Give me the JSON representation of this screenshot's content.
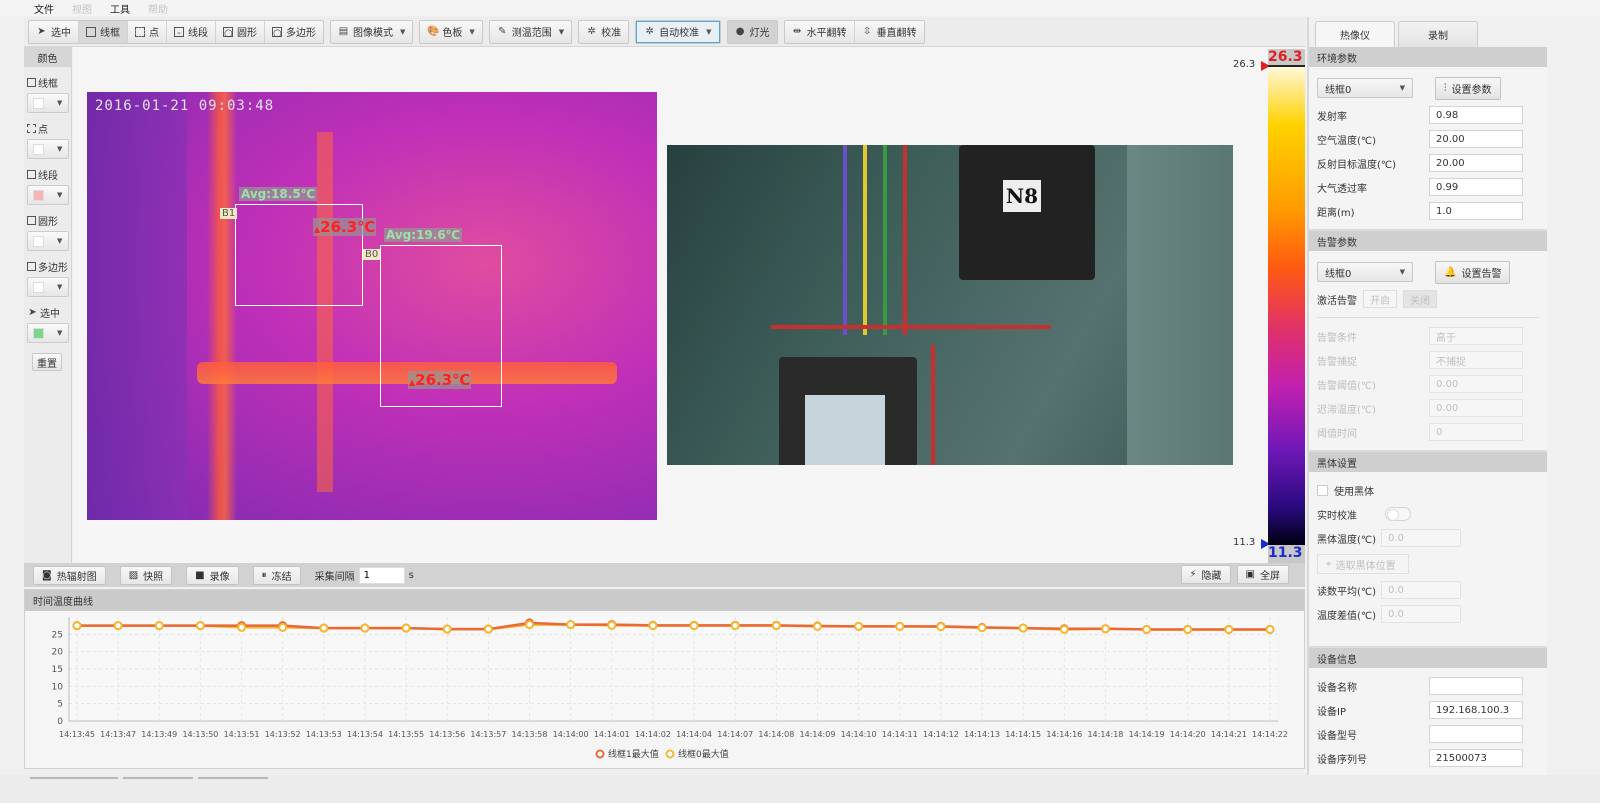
{
  "menu": [
    {
      "label": "文件",
      "enabled": true
    },
    {
      "label": "视图",
      "enabled": false
    },
    {
      "label": "工具",
      "enabled": true
    },
    {
      "label": "帮助",
      "enabled": false
    }
  ],
  "toolbar": {
    "draw_tools": [
      {
        "label": "选中",
        "icon": "pointer-icon"
      },
      {
        "label": "线框",
        "icon": "rect-icon",
        "active": true
      },
      {
        "label": "点",
        "icon": "point-icon"
      },
      {
        "label": "线段",
        "icon": "line-icon"
      },
      {
        "label": "圆形",
        "icon": "circle-icon"
      },
      {
        "label": "多边形",
        "icon": "polygon-icon"
      }
    ],
    "image_mode": "图像模式",
    "palette": "色板",
    "temp_range": "测温范围",
    "calibrate": "校准",
    "auto_calibrate": "自动校准",
    "light": "灯光",
    "hflip": "水平翻转",
    "vflip": "垂直翻转"
  },
  "left_panel": {
    "title": "颜色",
    "items": [
      {
        "label": "线框",
        "color": "#ffffff"
      },
      {
        "label": "点",
        "color": "#ffffff"
      },
      {
        "label": "线段",
        "color": "#f4b4b8"
      },
      {
        "label": "圆形",
        "color": "#ffffff"
      },
      {
        "label": "多边形",
        "color": "#ffffff"
      },
      {
        "label": "选中",
        "color": "#7ed68a"
      }
    ],
    "reset": "重置"
  },
  "thermal_view": {
    "timestamp": "2016-01-21 09:03:48",
    "rois": [
      {
        "id": "B1",
        "avg": "Avg:18.5℃",
        "max": "26.3℃"
      },
      {
        "id": "B0",
        "avg": "Avg:19.6℃",
        "max": "26.3℃"
      }
    ]
  },
  "visible_view": {
    "plate_label": "N8"
  },
  "color_scale": {
    "max": "26.3",
    "min": "11.3",
    "max_marker": "26.3",
    "min_marker": "11.3"
  },
  "bottom_bar": {
    "thermal_capture": "热辐射图",
    "snapshot": "快照",
    "record": "录像",
    "freeze": "冻结",
    "interval_label": "采集间隔",
    "interval_value": "1",
    "interval_unit": "s",
    "hide": "隐藏",
    "fullscreen": "全屏"
  },
  "chart_panel": {
    "title": "时间温度曲线"
  },
  "chart_data": {
    "type": "line",
    "title": "时间温度曲线",
    "xlabel": "",
    "ylabel": "",
    "ylim": [
      0,
      30
    ],
    "yticks": [
      0,
      5,
      10,
      15,
      20,
      25
    ],
    "grid": true,
    "legend_position": "bottom-center",
    "x": [
      "14:13:45",
      "14:13:47",
      "14:13:49",
      "14:13:50",
      "14:13:51",
      "14:13:52",
      "14:13:53",
      "14:13:54",
      "14:13:55",
      "14:13:56",
      "14:13:57",
      "14:13:58",
      "14:14:00",
      "14:14:01",
      "14:14:02",
      "14:14:04",
      "14:14:07",
      "14:14:08",
      "14:14:09",
      "14:14:10",
      "14:14:11",
      "14:14:12",
      "14:14:13",
      "14:14:15",
      "14:14:16",
      "14:14:18",
      "14:14:19",
      "14:14:20",
      "14:14:21",
      "14:14:22"
    ],
    "series": [
      {
        "name": "线框1最大值",
        "color": "#e86a3a",
        "values": [
          27.5,
          27.5,
          27.5,
          27.5,
          27.5,
          27.5,
          26.8,
          26.8,
          26.8,
          26.5,
          26.5,
          28.3,
          27.8,
          27.8,
          27.6,
          27.6,
          27.6,
          27.6,
          27.4,
          27.3,
          27.3,
          27.3,
          27.0,
          26.8,
          26.6,
          26.6,
          26.4,
          26.4,
          26.4,
          26.4
        ]
      },
      {
        "name": "线框0最大值",
        "color": "#f5b82e",
        "values": [
          27.5,
          27.5,
          27.5,
          27.5,
          27.0,
          27.0,
          26.8,
          26.8,
          26.8,
          26.5,
          26.5,
          27.8,
          27.8,
          27.6,
          27.5,
          27.5,
          27.5,
          27.5,
          27.3,
          27.3,
          27.3,
          27.2,
          26.9,
          26.8,
          26.4,
          26.6,
          26.4,
          26.4,
          26.4,
          26.4
        ]
      }
    ]
  },
  "right_panel": {
    "tabs": [
      {
        "label": "热像仪",
        "active": true
      },
      {
        "label": "录制",
        "active": false
      }
    ],
    "env": {
      "title": "环境参数",
      "roi_select": "线框0",
      "set_button": "设置参数",
      "fields": [
        {
          "label": "发射率",
          "value": "0.98"
        },
        {
          "label": "空气温度(℃)",
          "value": "20.00"
        },
        {
          "label": "反射目标温度(℃)",
          "value": "20.00"
        },
        {
          "label": "大气透过率",
          "value": "0.99"
        },
        {
          "label": "距离(m)",
          "value": "1.0"
        }
      ]
    },
    "alarm": {
      "title": "告警参数",
      "roi_select": "线框0",
      "set_button": "设置告警",
      "activate_label": "激活告警",
      "on": "开启",
      "off": "关闭",
      "fields": [
        {
          "label": "告警条件",
          "value": "高于"
        },
        {
          "label": "告警捕捉",
          "value": "不捕捉"
        },
        {
          "label": "告警阈值(℃)",
          "value": "0.00"
        },
        {
          "label": "迟滞温度(℃)",
          "value": "0.00"
        },
        {
          "label": "阈值时间",
          "value": "0"
        }
      ]
    },
    "blackbody": {
      "title": "黑体设置",
      "use_label": "使用黑体",
      "realtime_label": "实时校准",
      "temp_label": "黑体温度(℃)",
      "temp_value": "0.0",
      "pick_button": "选取黑体位置",
      "avg_label": "读数平均(℃)",
      "avg_value": "0.0",
      "diff_label": "温度差值(℃)",
      "diff_value": "0.0"
    },
    "device": {
      "title": "设备信息",
      "fields": [
        {
          "label": "设备名称",
          "value": ""
        },
        {
          "label": "设备IP",
          "value": "192.168.100.3"
        },
        {
          "label": "设备型号",
          "value": ""
        },
        {
          "label": "设备序列号",
          "value": "21500073"
        }
      ]
    }
  }
}
